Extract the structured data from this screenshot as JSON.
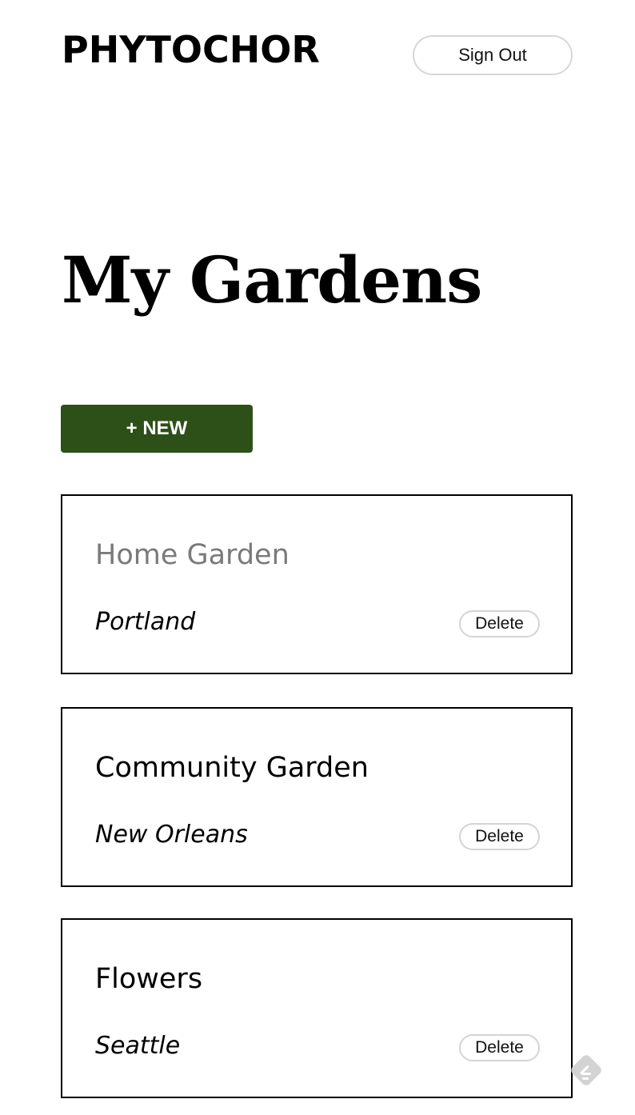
{
  "header": {
    "brand": "PHYTOCHOR",
    "sign_out_label": "Sign Out"
  },
  "main": {
    "title": "My Gardens",
    "new_button_label": "+ NEW",
    "gardens": [
      {
        "name": "Home Garden",
        "city": "Portland",
        "delete_label": "Delete"
      },
      {
        "name": "Community Garden",
        "city": "New Orleans",
        "delete_label": "Delete"
      },
      {
        "name": "Flowers",
        "city": "Seattle",
        "delete_label": "Delete"
      }
    ]
  },
  "colors": {
    "accent": "#2d5019",
    "muted_text": "#7a7a7a",
    "pill_border": "#d4d4d4",
    "widget_icon": "#cfcfcf"
  },
  "icons": {
    "floating_widget": "feedly-icon"
  }
}
